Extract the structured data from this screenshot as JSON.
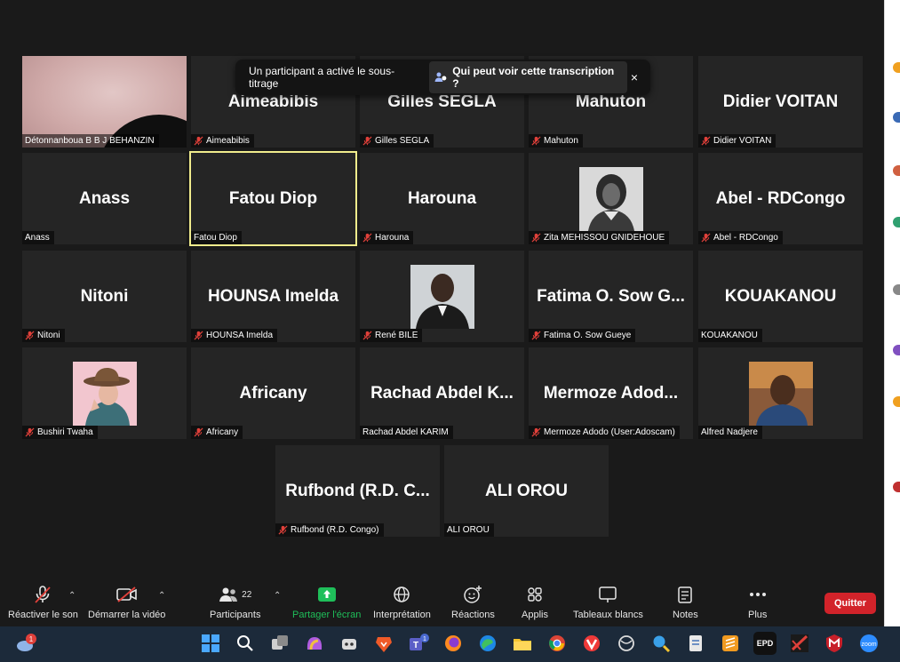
{
  "banner": {
    "message": "Un participant a activé le sous-titrage",
    "link": "Qui peut voir cette transcription ?",
    "close": "×"
  },
  "tiles": [
    {
      "name": "",
      "label": "Détonnanboua B B J BEHANZIN",
      "muted": false,
      "kind": "camera"
    },
    {
      "name": "Aimeabibis",
      "label": "Aimeabibis",
      "muted": true
    },
    {
      "name": "Gilles SEGLA",
      "label": "Gilles SEGLA",
      "muted": true
    },
    {
      "name": "Mahuton",
      "label": "Mahuton",
      "muted": true
    },
    {
      "name": "Didier VOITAN",
      "label": "Didier VOITAN",
      "muted": true
    },
    {
      "name": "Anass",
      "label": "Anass",
      "muted": false
    },
    {
      "name": "Fatou Diop",
      "label": "Fatou Diop",
      "muted": false,
      "active": true
    },
    {
      "name": "Harouna",
      "label": "Harouna",
      "muted": true
    },
    {
      "name": "",
      "label": "Zita MEHISSOU GNIDEHOUE",
      "muted": true,
      "kind": "photo-woman"
    },
    {
      "name": "Abel - RDCongo",
      "label": "Abel - RDCongo",
      "muted": true
    },
    {
      "name": "Nitoni",
      "label": "Nitoni",
      "muted": true
    },
    {
      "name": "HOUNSA Imelda",
      "label": "HOUNSA Imelda",
      "muted": true
    },
    {
      "name": "",
      "label": "René BILE",
      "muted": true,
      "kind": "photo-man"
    },
    {
      "name": "Fatima O. Sow G...",
      "label": "Fatima O. Sow Gueye",
      "muted": true
    },
    {
      "name": "KOUAKANOU",
      "label": "KOUAKANOU",
      "muted": false
    },
    {
      "name": "",
      "label": "Bushiri Twaha",
      "muted": true,
      "kind": "avatar-hat"
    },
    {
      "name": "Africany",
      "label": "Africany",
      "muted": true
    },
    {
      "name": "Rachad Abdel K...",
      "label": "Rachad Abdel KARIM",
      "muted": false
    },
    {
      "name": "Mermoze Adod...",
      "label": "Mermoze Adodo (User:Adoscam)",
      "muted": true
    },
    {
      "name": "",
      "label": "Alfred Nadjere",
      "muted": false,
      "kind": "photo-selfie"
    },
    {
      "name": "Rufbond (R.D. C...",
      "label": "Rufbond (R.D. Congo)",
      "muted": true
    },
    {
      "name": "ALI OROU",
      "label": "ALI OROU",
      "muted": false
    }
  ],
  "toolbar": {
    "unmute": "Réactiver le son",
    "start_video": "Démarrer la vidéo",
    "participants": "Participants",
    "participants_count": "22",
    "share": "Partager l'écran",
    "interpretation": "Interprétation",
    "reactions": "Réactions",
    "apps": "Applis",
    "whiteboards": "Tableaux blancs",
    "notes": "Notes",
    "more": "Plus",
    "quit": "Quitter"
  },
  "taskbar": {
    "weather_badge": "1",
    "teams_badge": "1",
    "epd_label": "EPD",
    "zoom_label": "zoom"
  },
  "colors": {
    "background": "#1a1a1a",
    "tile": "#252525",
    "active_border": "#f0ec8c",
    "mute_red": "#e0403a",
    "share_green": "#1fbf5a",
    "quit_red": "#d2232a",
    "taskbar": "#1c2a3a"
  }
}
